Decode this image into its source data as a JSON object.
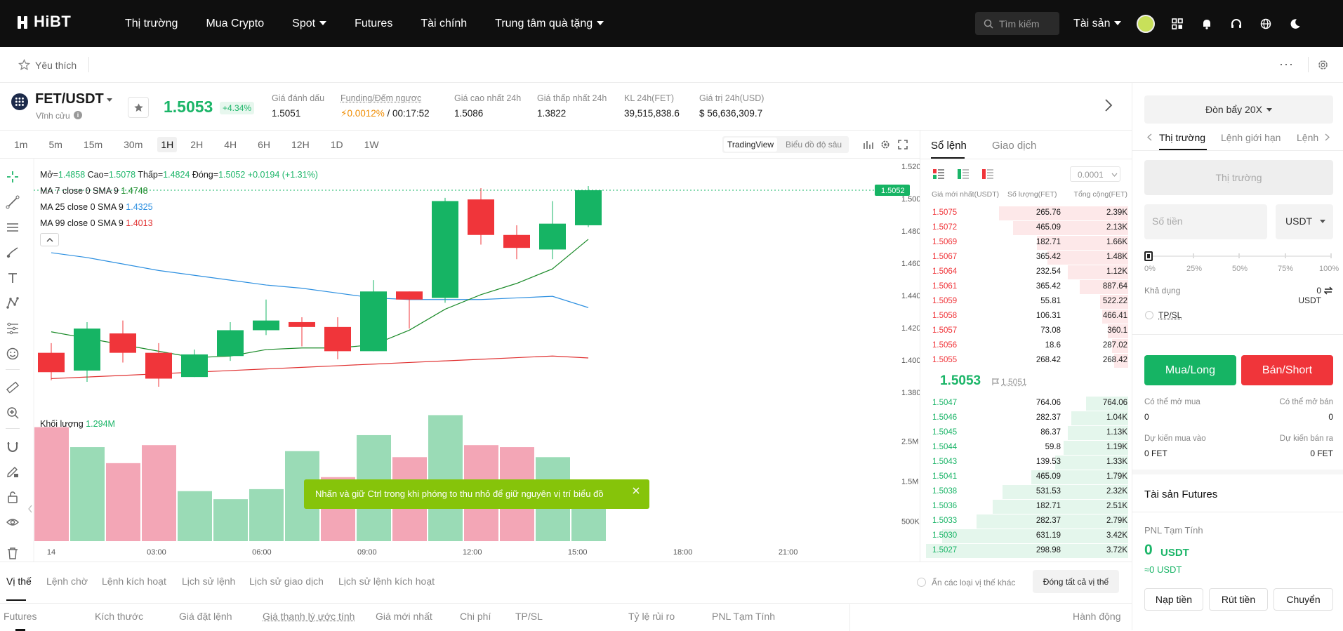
{
  "header": {
    "logo": "HiBT",
    "nav": [
      "Thị trường",
      "Mua Crypto",
      "Spot",
      "Futures",
      "Tài chính",
      "Trung tâm quà tặng"
    ],
    "search_placeholder": "Tìm kiếm",
    "assets": "Tài sản"
  },
  "favorites": {
    "label": "Yêu thích"
  },
  "pair": {
    "symbol": "FET/USDT",
    "type": "Vĩnh cửu",
    "last_price": "1.5053",
    "change": "+4.34%",
    "stats": [
      {
        "label": "Giá đánh dấu",
        "value": "1.5051"
      },
      {
        "label": "Funding/Đếm ngược",
        "value_rate": "0.0012%",
        "value_time": " / 00:17:52"
      },
      {
        "label": "Giá cao nhất 24h",
        "value": "1.5086"
      },
      {
        "label": "Giá thấp nhất 24h",
        "value": "1.3822"
      },
      {
        "label": "KL 24h(FET)",
        "value": "39,515,838.6"
      },
      {
        "label": "Giá trị 24h(USD)",
        "value": "$ 56,636,309.7"
      }
    ]
  },
  "timeframes": [
    "1m",
    "5m",
    "15m",
    "30m",
    "1H",
    "2H",
    "4H",
    "6H",
    "12H",
    "1D",
    "1W"
  ],
  "active_timeframe": "1H",
  "chart_views": [
    "TradingView",
    "Biểu đồ độ sâu"
  ],
  "legend": {
    "open_label": "Mở=",
    "open": "1.4858",
    "high_label": "Cao=",
    "high": "1.5078",
    "low_label": "Thấp=",
    "low": "1.4824",
    "close_label": "Đóng=",
    "close": "1.5052",
    "change": "+0.0194 (+1.31%)",
    "ma7_label": "MA 7 close 0 SMA 9",
    "ma7": "1.4748",
    "ma25_label": "MA 25 close 0 SMA 9",
    "ma25": "1.4325",
    "ma99_label": "MA 99 close 0 SMA 9",
    "ma99": "1.4013",
    "volume_label": "Khối lượng",
    "volume": "1.294M"
  },
  "chart_data": {
    "type": "candlestick",
    "y_ticks": [
      "1.5200",
      "1.5000",
      "1.4800",
      "1.4600",
      "1.4400",
      "1.4200",
      "1.4000",
      "1.3800"
    ],
    "vol_ticks": [
      "2.5M",
      "1.5M",
      "500K"
    ],
    "x_ticks": [
      "14",
      "03:00",
      "06:00",
      "09:00",
      "12:00",
      "15:00",
      "18:00",
      "21:00"
    ],
    "current_price_tag": "1.5052",
    "candles": [
      {
        "o": 1.4045,
        "h": 1.4105,
        "l": 1.3875,
        "c": 1.3925
      },
      {
        "o": 1.3935,
        "h": 1.4235,
        "l": 1.3865,
        "c": 1.4195
      },
      {
        "o": 1.4165,
        "h": 1.4245,
        "l": 1.3985,
        "c": 1.4045
      },
      {
        "o": 1.4045,
        "h": 1.4105,
        "l": 1.3835,
        "c": 1.3885
      },
      {
        "o": 1.3895,
        "h": 1.4065,
        "l": 1.3895,
        "c": 1.4035
      },
      {
        "o": 1.4025,
        "h": 1.4235,
        "l": 1.3995,
        "c": 1.4185
      },
      {
        "o": 1.4185,
        "h": 1.4375,
        "l": 1.4155,
        "c": 1.4245
      },
      {
        "o": 1.4235,
        "h": 1.4265,
        "l": 1.4085,
        "c": 1.4205
      },
      {
        "o": 1.4205,
        "h": 1.4265,
        "l": 1.4005,
        "c": 1.4055
      },
      {
        "o": 1.4055,
        "h": 1.4495,
        "l": 1.4055,
        "c": 1.4425
      },
      {
        "o": 1.4425,
        "h": 1.4425,
        "l": 1.4195,
        "c": 1.4375
      },
      {
        "o": 1.4385,
        "h": 1.5005,
        "l": 1.4355,
        "c": 1.4985
      },
      {
        "o": 1.4995,
        "h": 1.5065,
        "l": 1.4715,
        "c": 1.4775
      },
      {
        "o": 1.4775,
        "h": 1.4835,
        "l": 1.4625,
        "c": 1.4695
      },
      {
        "o": 1.4685,
        "h": 1.4985,
        "l": 1.4625,
        "c": 1.4845
      },
      {
        "o": 1.4835,
        "h": 1.5078,
        "l": 1.4824,
        "c": 1.5052
      }
    ],
    "ma7": [
      1.4175,
      1.4135,
      1.4095,
      1.4055,
      1.4015,
      1.4025,
      1.4065,
      1.4075,
      1.4075,
      1.4095,
      1.4185,
      1.4315,
      1.4405,
      1.4475,
      1.4565,
      1.4748
    ],
    "ma25": [
      1.4665,
      1.4635,
      1.4595,
      1.4555,
      1.4525,
      1.4495,
      1.4465,
      1.4445,
      1.4415,
      1.4385,
      1.4375,
      1.4375,
      1.4375,
      1.4385,
      1.4395,
      1.4325
    ],
    "ma99": [
      1.3885,
      1.3895,
      1.3905,
      1.3915,
      1.3925,
      1.3935,
      1.3945,
      1.3955,
      1.3965,
      1.3975,
      1.3985,
      1.3995,
      1.4005,
      1.4015,
      1.4025,
      1.4013
    ],
    "volumes": [
      2.85,
      2.35,
      1.95,
      2.4,
      1.25,
      1.05,
      1.3,
      2.25,
      1.6,
      2.65,
      2.1,
      3.15,
      2.4,
      2.35,
      2.1,
      1.294
    ],
    "vol_up": [
      false,
      true,
      false,
      false,
      true,
      true,
      true,
      true,
      false,
      true,
      false,
      true,
      false,
      false,
      true,
      true
    ]
  },
  "toast": "Nhấn và giữ Ctrl trong khi phóng to thu nhỏ để giữ nguyên vị trí biểu đồ",
  "orderbook": {
    "tabs": [
      "Sổ lệnh",
      "Giao dịch"
    ],
    "precision": "0.0001",
    "headers": [
      "Giá mới nhất(USDT)",
      "Số lượng(FET)",
      "Tổng cộng(FET)"
    ],
    "asks": [
      {
        "price": "1.5075",
        "qty": "265.76",
        "total": "2.39K",
        "depth": 0.64
      },
      {
        "price": "1.5072",
        "qty": "465.09",
        "total": "2.13K",
        "depth": 0.57
      },
      {
        "price": "1.5069",
        "qty": "182.71",
        "total": "1.66K",
        "depth": 0.45
      },
      {
        "price": "1.5067",
        "qty": "365.42",
        "total": "1.48K",
        "depth": 0.4
      },
      {
        "price": "1.5064",
        "qty": "232.54",
        "total": "1.12K",
        "depth": 0.3
      },
      {
        "price": "1.5061",
        "qty": "365.42",
        "total": "887.64",
        "depth": 0.24
      },
      {
        "price": "1.5059",
        "qty": "55.81",
        "total": "522.22",
        "depth": 0.14
      },
      {
        "price": "1.5058",
        "qty": "106.31",
        "total": "466.41",
        "depth": 0.13
      },
      {
        "price": "1.5057",
        "qty": "73.08",
        "total": "360.1",
        "depth": 0.1
      },
      {
        "price": "1.5056",
        "qty": "18.6",
        "total": "287.02",
        "depth": 0.08
      },
      {
        "price": "1.5055",
        "qty": "268.42",
        "total": "268.42",
        "depth": 0.07
      }
    ],
    "mid_price": "1.5053",
    "mark_price": "1.5051",
    "bids": [
      {
        "price": "1.5047",
        "qty": "764.06",
        "total": "764.06",
        "depth": 0.21
      },
      {
        "price": "1.5046",
        "qty": "282.37",
        "total": "1.04K",
        "depth": 0.28
      },
      {
        "price": "1.5045",
        "qty": "86.37",
        "total": "1.13K",
        "depth": 0.3
      },
      {
        "price": "1.5044",
        "qty": "59.8",
        "total": "1.19K",
        "depth": 0.32
      },
      {
        "price": "1.5043",
        "qty": "139.53",
        "total": "1.33K",
        "depth": 0.36
      },
      {
        "price": "1.5041",
        "qty": "465.09",
        "total": "1.79K",
        "depth": 0.48
      },
      {
        "price": "1.5038",
        "qty": "531.53",
        "total": "2.32K",
        "depth": 0.62
      },
      {
        "price": "1.5036",
        "qty": "182.71",
        "total": "2.51K",
        "depth": 0.67
      },
      {
        "price": "1.5033",
        "qty": "282.37",
        "total": "2.79K",
        "depth": 0.75
      },
      {
        "price": "1.5030",
        "qty": "631.19",
        "total": "3.42K",
        "depth": 0.92
      },
      {
        "price": "1.5027",
        "qty": "298.98",
        "total": "3.72K",
        "depth": 1.0
      }
    ]
  },
  "trade": {
    "leverage": "Đòn bẩy 20X",
    "order_tabs": [
      "Thị trường",
      "Lệnh giới hạn",
      "Lệnh"
    ],
    "price_placeholder": "Thị trường",
    "amount_placeholder": "Số tiền",
    "currency": "USDT",
    "slider_marks": [
      "0%",
      "25%",
      "50%",
      "75%",
      "100%"
    ],
    "available_label": "Khả dụng",
    "available_value": "0 USDT",
    "tpsl": "TP/SL",
    "buy": "Mua/Long",
    "sell": "Bán/Short",
    "can_buy_label": "Có thể mở mua",
    "can_buy": "0",
    "can_sell_label": "Có thể mở bán",
    "can_sell": "0",
    "est_buy_label": "Dự kiến mua vào",
    "est_buy": "0 FET",
    "est_sell_label": "Dự kiến bán ra",
    "est_sell": "0 FET",
    "futures_assets": "Tài sản Futures",
    "pnl_label": "PNL Tạm Tính",
    "pnl_value": "0",
    "pnl_unit": "USDT",
    "pnl_approx": "≈0 USDT",
    "deposit": "Nạp tiền",
    "withdraw": "Rút tiền",
    "transfer": "Chuyển"
  },
  "bottom": {
    "tabs": [
      "Vị thế",
      "Lệnh chờ",
      "Lệnh kích hoạt",
      "Lịch sử lệnh",
      "Lịch sử giao dịch",
      "Lịch sử lệnh kích hoạt"
    ],
    "hide_label": "Ẩn các loại vị thế khác",
    "close_all": "Đóng tất cả vị thế",
    "columns": [
      "Futures",
      "Kích thước",
      "Giá đặt lệnh",
      "Giá thanh lý ước tính",
      "Giá mới nhất",
      "Chi phí",
      "TP/SL",
      "Tỷ lệ rủi ro",
      "PNL Tạm Tính",
      "Hành động"
    ]
  }
}
